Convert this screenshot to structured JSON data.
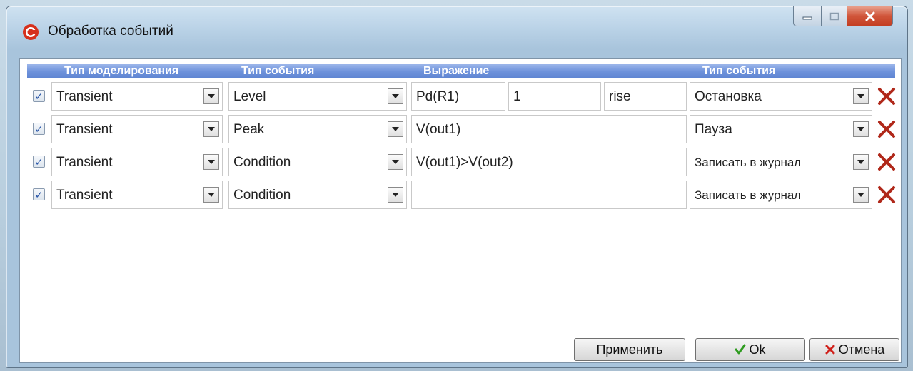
{
  "window": {
    "title": "Обработка событий"
  },
  "colors": {
    "accent_header": "#6f93dc",
    "app_icon": "#d6301c",
    "delete": "#b0281a",
    "ok_check": "#2e9b1f",
    "cancel_x": "#d0201a"
  },
  "headers": {
    "sim_type": "Тип моделирования",
    "event_type": "Тип события",
    "expression": "Выражение",
    "action_type": "Тип события"
  },
  "rows": [
    {
      "checked": true,
      "sim_type": "Transient",
      "event_type": "Level",
      "expression": "Pd(R1)",
      "threshold": "1",
      "edge": "rise",
      "action": "Остановка"
    },
    {
      "checked": true,
      "sim_type": "Transient",
      "event_type": "Peak",
      "expression": "V(out1)",
      "action": "Пауза"
    },
    {
      "checked": true,
      "sim_type": "Transient",
      "event_type": "Condition",
      "expression": "V(out1)>V(out2)",
      "action": "Записать в журнал"
    },
    {
      "checked": true,
      "sim_type": "Transient",
      "event_type": "Condition",
      "expression": "",
      "action": "Записать в журнал"
    }
  ],
  "buttons": {
    "apply": "Применить",
    "ok": "Ok",
    "cancel": "Отмена"
  },
  "icons": {
    "checkbox": "check-icon",
    "dropdown": "chevron-down-icon",
    "delete": "delete-x-icon",
    "ok": "checkmark-icon",
    "cancel": "close-icon"
  }
}
